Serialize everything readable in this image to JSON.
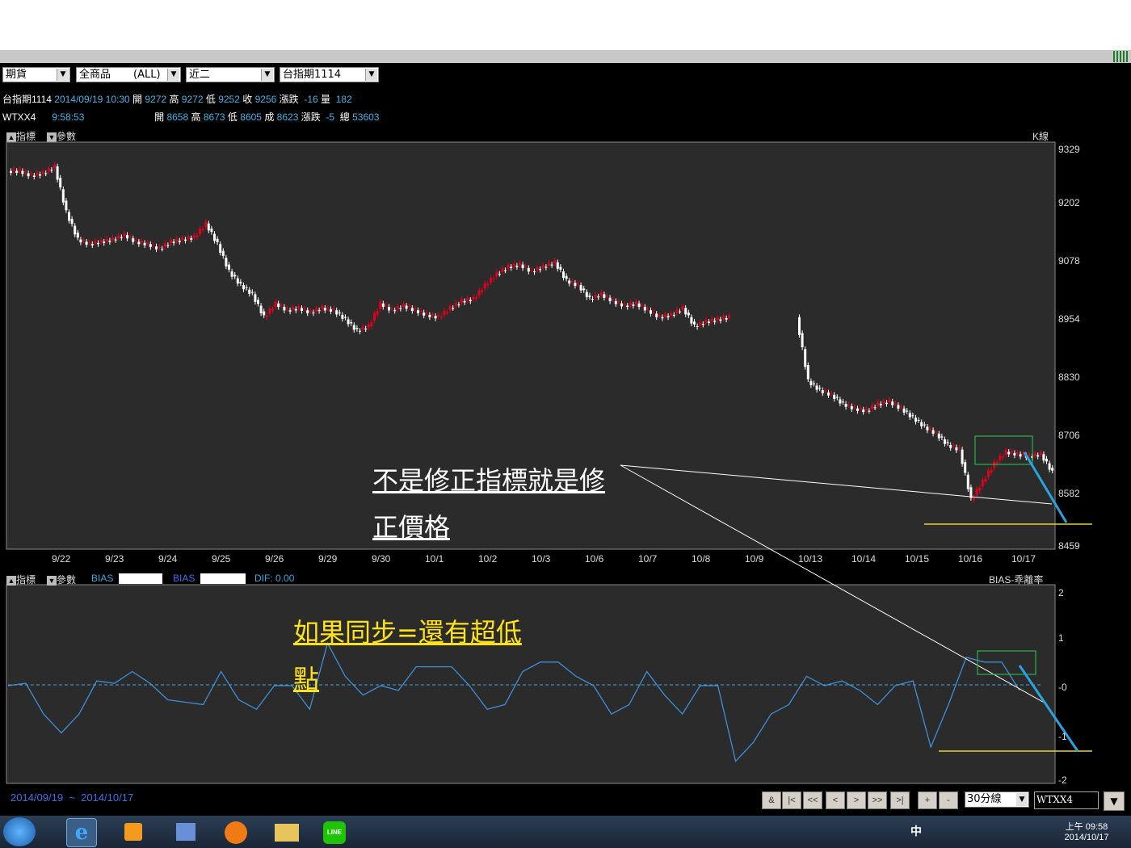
{
  "toolbar": {
    "selects": [
      "期貨",
      "全商品",
      "(ALL)",
      "近二",
      "台指期1114"
    ],
    "chart_type": "30分線",
    "symbol_box": "WTXX4"
  },
  "quote1": {
    "name": "台指期1114",
    "datetime": "2014/09/19 10:30",
    "open_label": "開",
    "open": "9272",
    "high_label": "高",
    "high": "9272",
    "low_label": "低",
    "low": "9252",
    "close_label": "收",
    "close": "9256",
    "chg_label": "漲跌",
    "chg": "-16",
    "vol_label": "量",
    "vol": "182"
  },
  "quote2": {
    "name": "WTXX4",
    "time": "9:58:53",
    "open_label": "開",
    "open": "8658",
    "high_label": "高",
    "high": "8673",
    "low_label": "低",
    "low": "8605",
    "close_label": "成",
    "close": "8623",
    "chg_label": "漲跌",
    "chg": "-5",
    "vol_label": "總",
    "vol": "53603"
  },
  "main_panel": {
    "tab1": "指標",
    "tab2": "參數",
    "title": "K線"
  },
  "sub_panel": {
    "tab1": "指標",
    "tab2": "參數",
    "bias1": "BIAS",
    "bias2": "BIAS",
    "dif_label": "DIF:",
    "dif": "0.00",
    "title": "BIAS-乖離率"
  },
  "date_range": {
    "from": "2014/09/19",
    "sep": "~",
    "to": "2014/10/17"
  },
  "nav_buttons": [
    "&",
    "|<",
    "<<",
    "<",
    ">",
    ">>",
    ">|",
    "+",
    "-"
  ],
  "annotations": {
    "main_line1": "不是修正指標就是修",
    "main_line2": "正價格",
    "sub_line1": "如果同步=還有超低",
    "sub_line2": "點"
  },
  "taskbar": {
    "ime": "中",
    "time": "上午 09:58",
    "date": "2014/10/17"
  },
  "colors": {
    "up": "#e0001b",
    "down": "#ffffff",
    "bias_line": "#3d8fd9",
    "annotation_white": "#ffffff",
    "annotation_yellow": "#ffe21a",
    "highlight_box": "#2bb34a",
    "arrow": "#29a3e0"
  },
  "chart_data": [
    {
      "type": "candlestick",
      "title": "K線",
      "x_ticks": [
        "9/22",
        "9/23",
        "9/24",
        "9/25",
        "9/26",
        "9/29",
        "9/30",
        "10/1",
        "10/2",
        "10/3",
        "10/6",
        "10/7",
        "10/8",
        "10/9",
        "10/13",
        "10/14",
        "10/15",
        "10/16",
        "10/17"
      ],
      "y_ticks": [
        9329,
        9202,
        9078,
        8954,
        8830,
        8706,
        8582,
        8459
      ],
      "ylim": [
        8459,
        9329
      ],
      "close_path": [
        9280,
        9270,
        9275,
        9290,
        9190,
        9130,
        9120,
        9125,
        9130,
        9140,
        9125,
        9120,
        9110,
        9125,
        9130,
        9135,
        9165,
        9120,
        9060,
        9030,
        9010,
        8960,
        8990,
        8975,
        8980,
        8970,
        8980,
        8975,
        8955,
        8930,
        8940,
        8990,
        8975,
        8985,
        8975,
        8965,
        8960,
        8980,
        8995,
        9000,
        9030,
        9055,
        9070,
        9075,
        9060,
        9070,
        9080,
        9040,
        9030,
        9000,
        9010,
        8995,
        8985,
        8990,
        8975,
        8960,
        8965,
        8980,
        8940,
        8950,
        8955,
        8960,
        8820,
        8800,
        8790,
        8770,
        8760,
        8755,
        8770,
        8775,
        8760,
        8740,
        8720,
        8705,
        8680,
        8670,
        8560,
        8600,
        8640,
        8665,
        8660,
        8655,
        8660,
        8620
      ]
    },
    {
      "type": "line",
      "title": "BIAS-乖離率",
      "y_ticks": [
        2,
        1,
        0,
        -1,
        -2
      ],
      "ylim": [
        -2,
        2
      ],
      "series": [
        {
          "name": "BIAS",
          "values": [
            0,
            0.05,
            -0.6,
            -1,
            -0.6,
            0.1,
            0.05,
            0.3,
            0.05,
            -0.3,
            -0.35,
            -0.4,
            0.3,
            -0.3,
            -0.5,
            0,
            0,
            -0.5,
            0.9,
            0.2,
            -0.2,
            0,
            -0.1,
            0.4,
            0.4,
            0.4,
            0,
            -0.5,
            -0.4,
            0.3,
            0.5,
            0.5,
            0.2,
            0,
            -0.6,
            -0.4,
            0.3,
            -0.2,
            -0.6,
            0,
            0,
            -1.6,
            -1.2,
            -0.6,
            -0.4,
            0.2,
            0,
            0.1,
            -0.1,
            -0.4,
            0,
            0.1,
            -1.3,
            -0.4,
            0.6,
            0.5,
            0.5,
            -0.1
          ]
        }
      ]
    }
  ]
}
